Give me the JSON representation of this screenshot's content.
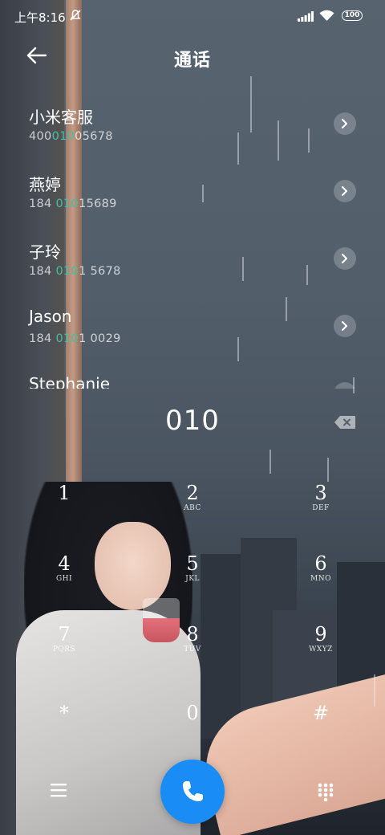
{
  "status_bar": {
    "time": "上午8:16",
    "battery": "100",
    "icons": [
      "mute-icon",
      "signal-icon",
      "wifi-icon",
      "battery-icon"
    ]
  },
  "header": {
    "title": "通话",
    "back_icon": "arrow-left-icon"
  },
  "contacts": [
    {
      "name": "小米客服",
      "number_pre": "400",
      "number_match": "010",
      "number_post": "05678"
    },
    {
      "name": "燕婷",
      "number_pre": "184 ",
      "number_match": "010",
      "number_post": "15689"
    },
    {
      "name": "子玲",
      "number_pre": "184 ",
      "number_match": "010",
      "number_post": "1 5678"
    },
    {
      "name": "Jason",
      "number_pre": "184 ",
      "number_match": "010",
      "number_post": "1 0029"
    },
    {
      "name": "Stephanie",
      "number_pre": "",
      "number_match": "",
      "number_post": ""
    }
  ],
  "dialer": {
    "input_value": "010",
    "keys": [
      {
        "digit": "1",
        "letters": ""
      },
      {
        "digit": "2",
        "letters": "ABC"
      },
      {
        "digit": "3",
        "letters": "DEF"
      },
      {
        "digit": "4",
        "letters": "GHI"
      },
      {
        "digit": "5",
        "letters": "JKL"
      },
      {
        "digit": "6",
        "letters": "MNO"
      },
      {
        "digit": "7",
        "letters": "PQRS"
      },
      {
        "digit": "8",
        "letters": "TUV"
      },
      {
        "digit": "9",
        "letters": "WXYZ"
      },
      {
        "digit": "*",
        "letters": ""
      },
      {
        "digit": "0",
        "letters": ""
      },
      {
        "digit": "#",
        "letters": ""
      }
    ]
  },
  "bottom_bar": {
    "left_icon": "menu-icon",
    "center_icon": "phone-icon",
    "right_icon": "dialpad-icon",
    "call_color": "#1a8cf5"
  },
  "colors": {
    "match_highlight": "#3fc2a4",
    "call_button": "#1a8cf5"
  }
}
